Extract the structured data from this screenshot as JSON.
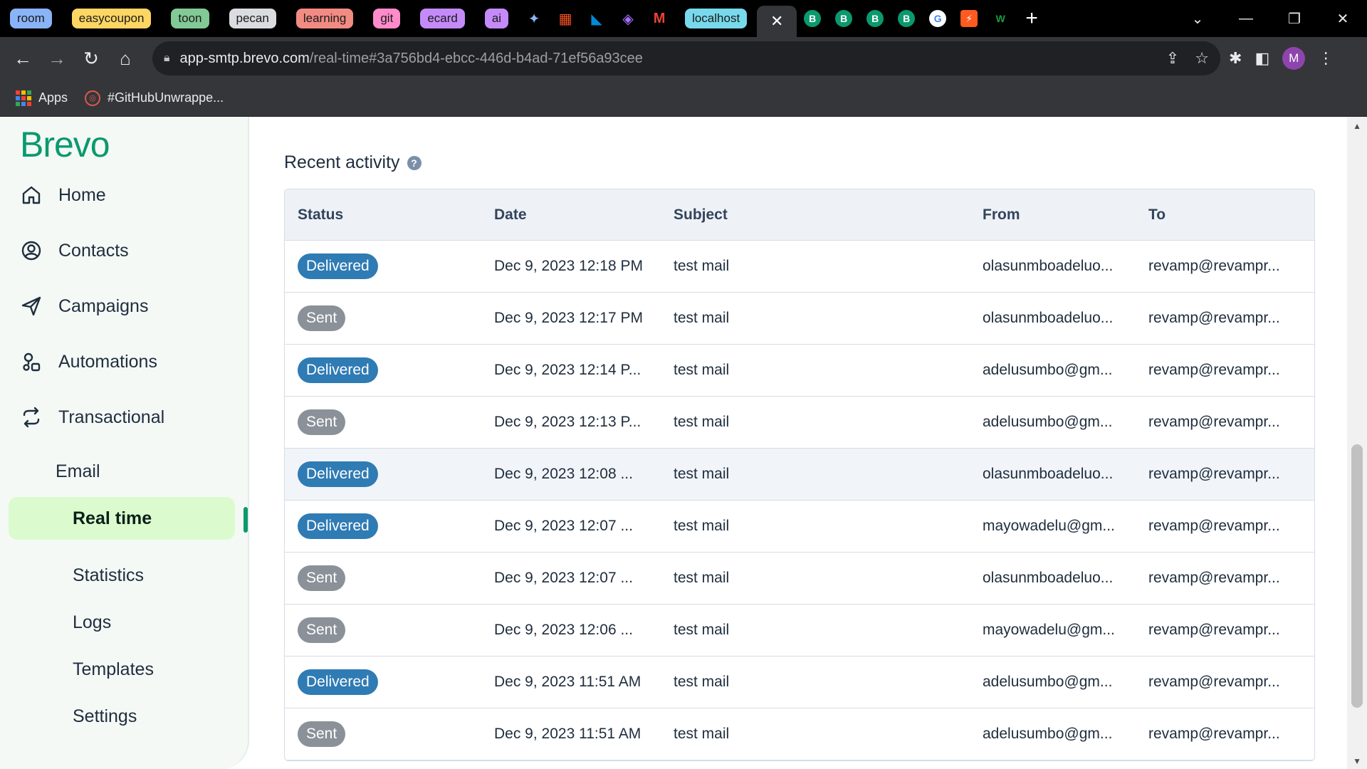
{
  "browser": {
    "tab_groups": [
      {
        "label": "room",
        "color": "#8ab4f8"
      },
      {
        "label": "easycoupon",
        "color": "#fdd663"
      },
      {
        "label": "toon",
        "color": "#81c995"
      },
      {
        "label": "pecan",
        "color": "#dadce0"
      },
      {
        "label": "learning",
        "color": "#f28b82"
      },
      {
        "label": "git",
        "color": "#ff8bcb"
      },
      {
        "label": "ecard",
        "color": "#c58af9"
      },
      {
        "label": "ai",
        "color": "#c58af9"
      }
    ],
    "icon_tabs_left": [
      "gemini-icon",
      "microsoft-icon",
      "azure-icon",
      "visual-studio-icon",
      "gmail-icon"
    ],
    "localhost_tab": {
      "label": "localhost",
      "color": "#78d9ec"
    },
    "active_tab_close": "✕",
    "icon_tabs_right": [
      {
        "name": "brevo-icon",
        "glyph": "B"
      },
      {
        "name": "brevo-icon",
        "glyph": "B"
      },
      {
        "name": "brevo-icon",
        "glyph": "B"
      },
      {
        "name": "brevo-icon",
        "glyph": "B"
      },
      {
        "name": "google-icon",
        "glyph": "G"
      },
      {
        "name": "bolt-icon",
        "glyph": "⚡"
      },
      {
        "name": "webflow-icon",
        "glyph": "W"
      }
    ],
    "new_tab": "+",
    "url_host": "app-smtp.brevo.com",
    "url_path": "/real-time#3a756bd4-ebcc-446d-b4ad-71ef56a93cee",
    "avatar_letter": "M",
    "bookmarks": [
      {
        "label": "Apps"
      },
      {
        "label": "#GitHubUnwrappe..."
      }
    ]
  },
  "sidebar": {
    "logo": "Brevo",
    "items": [
      {
        "label": "Home"
      },
      {
        "label": "Contacts"
      },
      {
        "label": "Campaigns"
      },
      {
        "label": "Automations"
      },
      {
        "label": "Transactional"
      }
    ],
    "email_label": "Email",
    "sub_items": [
      {
        "label": "Real time",
        "active": true
      },
      {
        "label": "Statistics"
      },
      {
        "label": "Logs"
      },
      {
        "label": "Templates"
      },
      {
        "label": "Settings"
      }
    ]
  },
  "main": {
    "section_title": "Recent activity",
    "help_glyph": "?",
    "table": {
      "headers": [
        "Status",
        "Date",
        "Subject",
        "From",
        "To"
      ],
      "rows": [
        {
          "status": "Delivered",
          "date": "Dec 9, 2023 12:18 PM",
          "subject": "test mail",
          "from": "olasunmboadeluo...",
          "to": "revamp@revampr..."
        },
        {
          "status": "Sent",
          "date": "Dec 9, 2023 12:17 PM",
          "subject": "test mail",
          "from": "olasunmboadeluo...",
          "to": "revamp@revampr..."
        },
        {
          "status": "Delivered",
          "date": "Dec 9, 2023 12:14 P...",
          "subject": "test mail",
          "from": "adelusumbo@gm...",
          "to": "revamp@revampr..."
        },
        {
          "status": "Sent",
          "date": "Dec 9, 2023 12:13 P...",
          "subject": "test mail",
          "from": "adelusumbo@gm...",
          "to": "revamp@revampr..."
        },
        {
          "status": "Delivered",
          "date": "Dec 9, 2023 12:08 ...",
          "subject": "test mail",
          "from": "olasunmboadeluo...",
          "to": "revamp@revampr...",
          "highlight": true
        },
        {
          "status": "Delivered",
          "date": "Dec 9, 2023 12:07 ...",
          "subject": "test mail",
          "from": "mayowadelu@gm...",
          "to": "revamp@revampr..."
        },
        {
          "status": "Sent",
          "date": "Dec 9, 2023 12:07 ...",
          "subject": "test mail",
          "from": "olasunmboadeluo...",
          "to": "revamp@revampr..."
        },
        {
          "status": "Sent",
          "date": "Dec 9, 2023 12:06 ...",
          "subject": "test mail",
          "from": "mayowadelu@gm...",
          "to": "revamp@revampr..."
        },
        {
          "status": "Delivered",
          "date": "Dec 9, 2023 11:51 AM",
          "subject": "test mail",
          "from": "adelusumbo@gm...",
          "to": "revamp@revampr..."
        },
        {
          "status": "Sent",
          "date": "Dec 9, 2023 11:51 AM",
          "subject": "test mail",
          "from": "adelusumbo@gm...",
          "to": "revamp@revampr..."
        }
      ]
    }
  },
  "colors": {
    "brand": "#0b996e",
    "active_bg": "#dbfbcf",
    "delivered": "#2f7bb4",
    "sent": "#8a9199"
  }
}
